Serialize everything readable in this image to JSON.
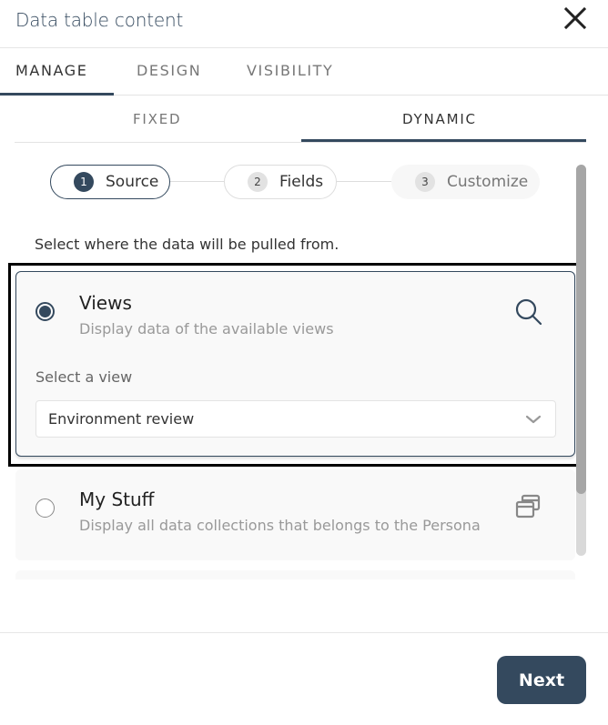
{
  "header": {
    "title": "Data table content",
    "close_icon": "close-icon"
  },
  "tabs": [
    {
      "label": "MANAGE",
      "active": true
    },
    {
      "label": "DESIGN",
      "active": false
    },
    {
      "label": "VISIBILITY",
      "active": false
    }
  ],
  "subtabs": [
    {
      "label": "FIXED",
      "active": false
    },
    {
      "label": "DYNAMIC",
      "active": true
    }
  ],
  "stepper": [
    {
      "number": "1",
      "label": "Source",
      "state": "active"
    },
    {
      "number": "2",
      "label": "Fields",
      "state": "upcoming"
    },
    {
      "number": "3",
      "label": "Customize",
      "state": "disabled"
    }
  ],
  "instruction": "Select where the data will be pulled from.",
  "sources": [
    {
      "title": "Views",
      "description": "Display data of the available views",
      "icon": "search-icon",
      "selected": true,
      "select_label": "Select a view",
      "select_value": "Environment review"
    },
    {
      "title": "My Stuff",
      "description": "Display all data collections that belongs to the Persona",
      "icon": "collections-icon",
      "selected": false
    }
  ],
  "footer": {
    "next_label": "Next"
  },
  "colors": {
    "primary": "#34495e",
    "muted_text": "#999999",
    "card_bg": "#f9f9f9"
  }
}
